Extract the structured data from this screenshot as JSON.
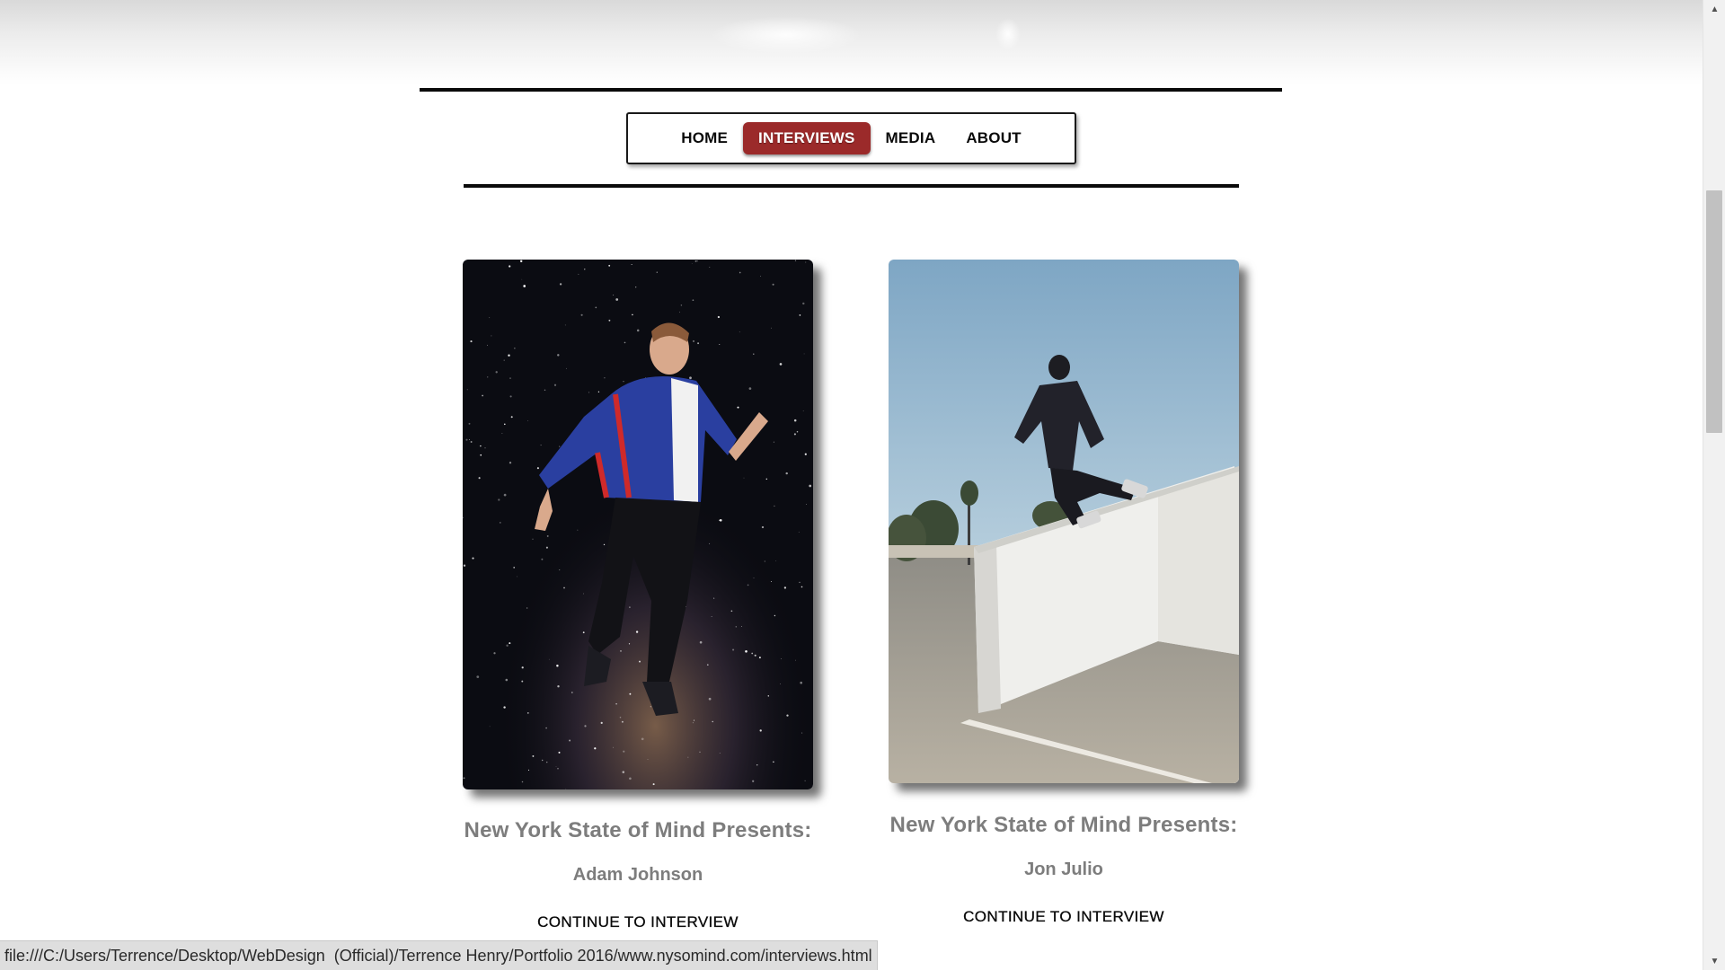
{
  "nav": {
    "items": [
      {
        "label": "HOME",
        "active": false
      },
      {
        "label": "INTERVIEWS",
        "active": true
      },
      {
        "label": "MEDIA",
        "active": false
      },
      {
        "label": "ABOUT",
        "active": false
      }
    ]
  },
  "cards": [
    {
      "presents": "New York State of Mind Presents:",
      "name": "Adam Johnson",
      "link": "CONTINUE TO INTERVIEW"
    },
    {
      "presents": "New York State of Mind Presents:",
      "name": "Jon Julio",
      "link": "CONTINUE TO INTERVIEW"
    }
  ],
  "status_bar": {
    "url": "file:///C:/Users/Terrence/Desktop/WebDesign  (Official)/Terrence Henry/Portfolio 2016/www.nysomind.com/interviews.html"
  },
  "colors": {
    "accent": "#9b2a2a",
    "heading_gray": "#7d7d7d"
  }
}
